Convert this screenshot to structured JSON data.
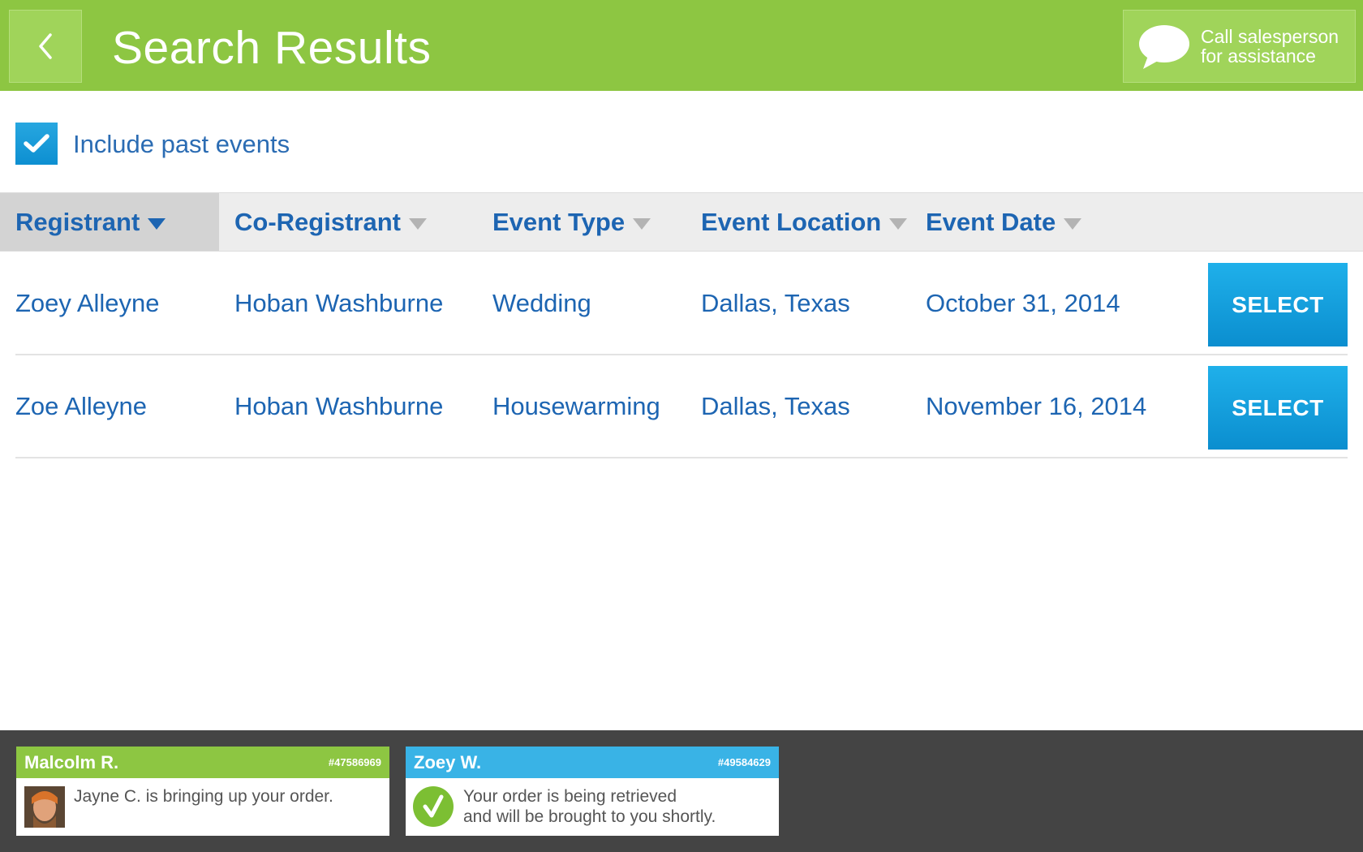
{
  "header": {
    "title": "Search Results",
    "back_icon": "chevron-left-icon",
    "call_lines": [
      "Call salesperson",
      "for assistance"
    ],
    "call_icon": "speech-bubble-icon",
    "bg_color": "#8dc642"
  },
  "filter": {
    "include_past_label": "Include past events",
    "include_past_checked": true
  },
  "table": {
    "columns": [
      {
        "label": "Registrant",
        "sorted": true
      },
      {
        "label": "Co-Registrant",
        "sorted": false
      },
      {
        "label": "Event Type",
        "sorted": false
      },
      {
        "label": "Event Location",
        "sorted": false
      },
      {
        "label": "Event Date",
        "sorted": false
      }
    ],
    "rows": [
      {
        "registrant": "Zoey Alleyne",
        "co_registrant": "Hoban Washburne",
        "event_type": "Wedding",
        "location": "Dallas, Texas",
        "date": "October 31, 2014",
        "action": "SELECT"
      },
      {
        "registrant": "Zoe Alleyne",
        "co_registrant": "Hoban Washburne",
        "event_type": "Housewarming",
        "location": "Dallas, Texas",
        "date": "November 16, 2014",
        "action": "SELECT"
      }
    ]
  },
  "notifications": [
    {
      "name": "Malcolm R.",
      "number": "#47586969",
      "message": "Jayne C. is bringing up your order.",
      "color": "#8dc642",
      "icon": "avatar"
    },
    {
      "name": "Zoey W.",
      "number": "#49584629",
      "message_lines": [
        "Your order is being retrieved",
        "and will be brought to you shortly."
      ],
      "color": "#39b3e6",
      "icon": "checkmark-circle-icon"
    }
  ]
}
